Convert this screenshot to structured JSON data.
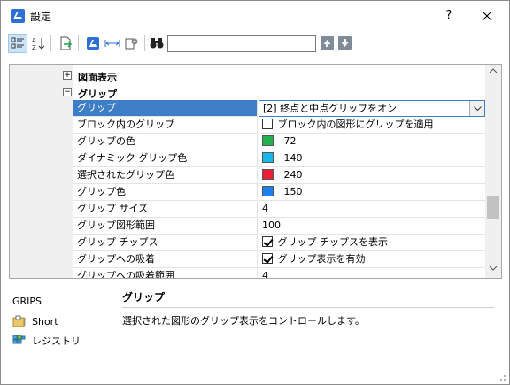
{
  "window": {
    "title": "設定"
  },
  "titlebar": {
    "help_label": "?"
  },
  "toolbar": {
    "search": {
      "value": "",
      "placeholder": ""
    }
  },
  "grid": {
    "groups": [
      {
        "label": "図面表示",
        "expanded": false
      },
      {
        "label": "グリップ",
        "expanded": true
      }
    ],
    "rows": [
      {
        "name": "グリップ",
        "value": "[2] 終点と中点グリップをオン",
        "kind": "combo",
        "selected": true
      },
      {
        "name": "ブロック内のグリップ",
        "value": "ブロック内の図形にグリップを適用",
        "kind": "checkbox",
        "checked": false
      },
      {
        "name": "グリップの色",
        "value": "72",
        "kind": "color",
        "color": "#22b14c"
      },
      {
        "name": "ダイナミック グリップ色",
        "value": "140",
        "kind": "color",
        "color": "#18b8e8"
      },
      {
        "name": "選択されたグリップ色",
        "value": "240",
        "kind": "color",
        "color": "#ee1c3c"
      },
      {
        "name": "グリップ色",
        "value": "150",
        "kind": "color",
        "color": "#1e7ef0"
      },
      {
        "name": "グリップ サイズ",
        "value": "4",
        "kind": "text"
      },
      {
        "name": "グリップ図形範囲",
        "value": "100",
        "kind": "text"
      },
      {
        "name": "グリップ チップス",
        "value": "グリップ チップスを表示",
        "kind": "checkbox",
        "checked": true
      },
      {
        "name": "グリップへの吸着",
        "value": "グリップ表示を有効",
        "kind": "checkbox",
        "checked": true
      },
      {
        "name": "グリップへの吸着範囲",
        "value": "4",
        "kind": "text"
      }
    ]
  },
  "sidebar": {
    "variable": "GRIPS",
    "items": [
      {
        "label": "Short",
        "icon": "folder-icon"
      },
      {
        "label": "レジストリ",
        "icon": "registry-icon"
      }
    ]
  },
  "description": {
    "title": "グリップ",
    "text": "選択された図形のグリップ表示をコントロールします。"
  }
}
